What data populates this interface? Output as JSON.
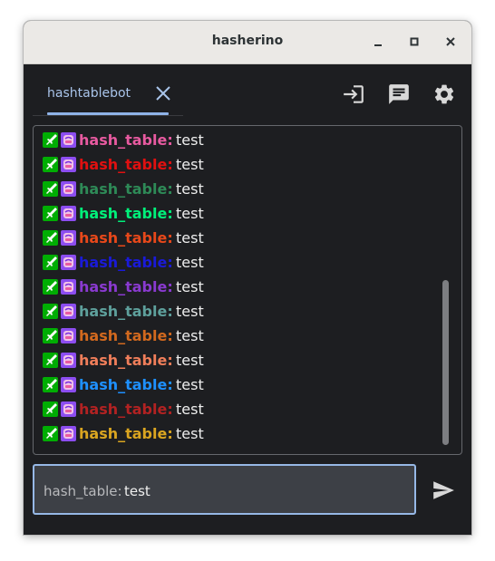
{
  "window": {
    "title": "hasherino"
  },
  "titlebar": {
    "minimize_icon": "minimize-icon",
    "maximize_icon": "maximize-icon",
    "close_icon": "close-icon"
  },
  "tabs": [
    {
      "label": "hashtablebot",
      "close_icon": "close-icon"
    }
  ],
  "header_icons": [
    "login-icon",
    "chat-icon",
    "settings-gear-icon"
  ],
  "chat": {
    "messages": [
      {
        "user": "hash_table:",
        "text": "test",
        "color": "#e85aa0"
      },
      {
        "user": "hash_table:",
        "text": "test",
        "color": "#e01010"
      },
      {
        "user": "hash_table:",
        "text": "test",
        "color": "#2e8a57"
      },
      {
        "user": "hash_table:",
        "text": "test",
        "color": "#00f07a"
      },
      {
        "user": "hash_table:",
        "text": "test",
        "color": "#e8481a"
      },
      {
        "user": "hash_table:",
        "text": "test",
        "color": "#1a1ad8"
      },
      {
        "user": "hash_table:",
        "text": "test",
        "color": "#8a3ad0"
      },
      {
        "user": "hash_table:",
        "text": "test",
        "color": "#5ea09c"
      },
      {
        "user": "hash_table:",
        "text": "test",
        "color": "#d2691e"
      },
      {
        "user": "hash_table:",
        "text": "test",
        "color": "#f07e5a"
      },
      {
        "user": "hash_table:",
        "text": "test",
        "color": "#1e90ff"
      },
      {
        "user": "hash_table:",
        "text": "test",
        "color": "#b22222"
      },
      {
        "user": "hash_table:",
        "text": "test",
        "color": "#daa520"
      }
    ],
    "badges": [
      "moderator-sword-icon",
      "subscriber-icon"
    ]
  },
  "input": {
    "reply_prefix": "hash_table:",
    "value": "test"
  },
  "send_icon": "send-icon"
}
